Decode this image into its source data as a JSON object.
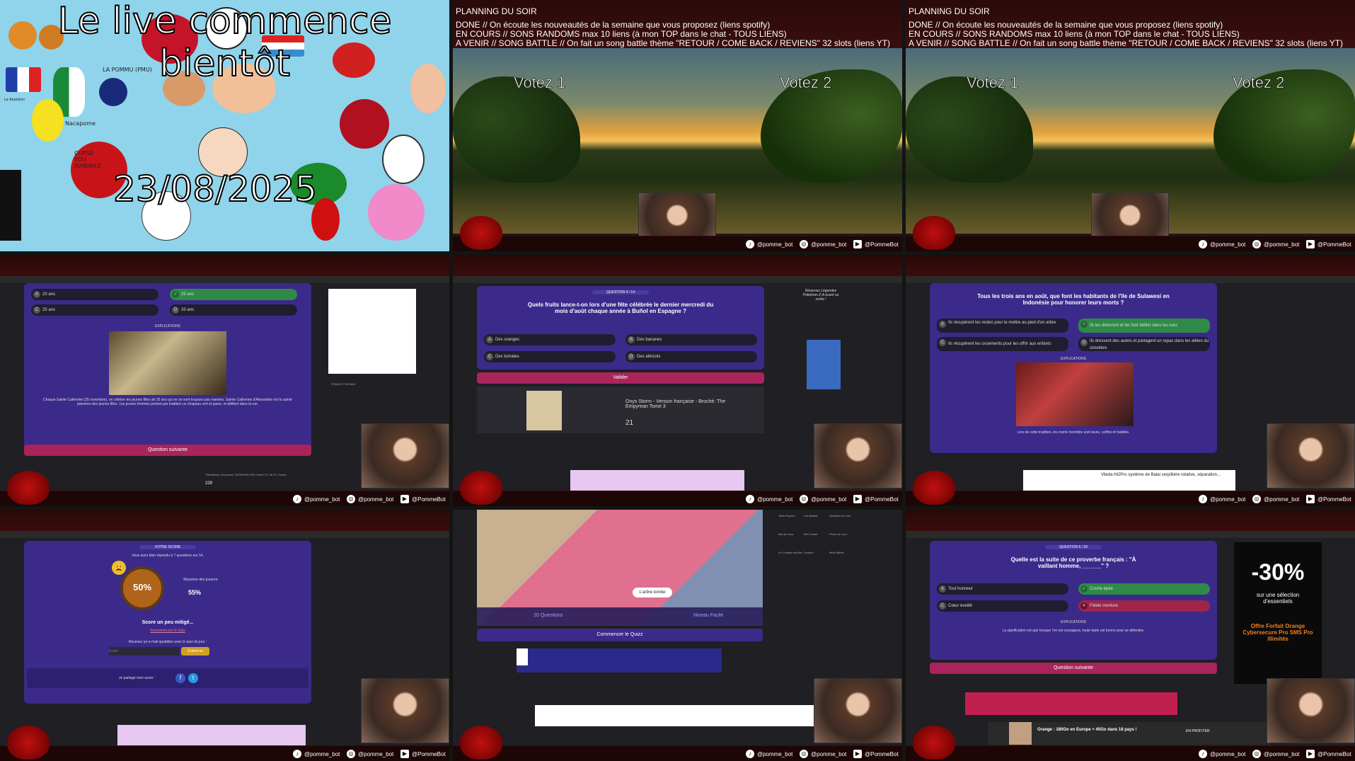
{
  "tile0": {
    "title": "Le live commence bientôt",
    "date": "23/08/2025",
    "labels": [
      "LA POMMU (PMU)",
      "CURSE YOU ISHBAYLE",
      "Nacapome",
      "La Koalaton"
    ]
  },
  "stream": {
    "planning_title": "PLANNING DU SOIR",
    "line_done": "DONE // On écoute les nouveautés de la semaine que vous proposez (liens spotify)",
    "line_current": "EN COURS // SONS RANDOMS max 10 liens (à mon TOP dans le chat - TOUS LIENS)",
    "line_next": "A VENIR // SONG BATTLE // On fait un song battle  thème \"RETOUR / COME BACK / REVIENS\" 32 slots (liens YT)",
    "vote1": "Votez 1",
    "vote2": "Votez 2"
  },
  "socials": {
    "tiktok": "@pomme_bot",
    "instagram": "@pomme_bot",
    "youtube": "@PommeBot"
  },
  "tile3": {
    "options": [
      "20 ans",
      "25 ans",
      "25 ans",
      "33 ans"
    ],
    "explications": "EXPLICATIONS",
    "explanation": "Chaque Sainte Catherine (25 novembre), on célèbre les jeunes filles de 25 ans qui ne se sont toujours pas mariées. Sainte Catherine d'Alexandrie est la sainte patronne des jeunes filles. Les jeunes femmes portent par tradition un chapeau vert et jaune, et défilent dans la rue.",
    "next": "Question suivante",
    "ad_title": "STANLEY FATMAX",
    "ad_sub": "Téléviseurs 40 pouces THOMSON FHD Smart TV, Wi-Fi, Contrô...",
    "ad_price": "229"
  },
  "tile4": {
    "tag": "QUESTION 4 / 14",
    "question": "Quels fruits lance-t-on lors d'une fête célébrée le dernier mercredi du mois d'août chaque année à Buñol en Espagne ?",
    "options": [
      "Des oranges",
      "Des bananes",
      "Des tomates",
      "Des abricots"
    ],
    "submit": "Valider",
    "book": "Onyx Storm - Version française - Broché: The Empyrean Tome 3",
    "book_price": "21",
    "pokemon": "Réservez Légendes Pokémon Z-A avant sa sortie !"
  },
  "tile5": {
    "question": "Tous les trois ans en août, que font les habitants de l'île de Sulawesi en Indonésie pour honorer leurs morts ?",
    "options": [
      "Ils récupèrent les restes pour le mettre au pied d'un arbre",
      "Ils les déterrent et les font défiler dans les rues",
      "Ils récupèrent les ossements pour les offrir aux enfants",
      "Ils dressent des autels et partagent un repas dans les allées du cimetière"
    ],
    "explications": "EXPLICATIONS",
    "caption": "Lors de cette tradition, les morts momifiés sont lavés, coiffés et habillés.",
    "ad": "Vileda Hi2Pro système de Balai serpillière rotative, séparation..."
  },
  "tile6": {
    "tag": "VOTRE SCORE",
    "intro": "Vous avez bien répondu à 7 questions sur 14.",
    "percent": "50%",
    "avg_label": "Moyenne des joueurs:",
    "avg": "55%",
    "verdict": "Score un peu mitigé...",
    "retry": "Recommencer le Quiz",
    "newsletter": "Recevez un e-mail quotidien avec le quiz du jour :",
    "email_placeholder": "Email",
    "subscribe": "S'abonner",
    "share": "Je partage mon score :"
  },
  "tile7": {
    "questions": "20 Questions",
    "level": "Niveau Facile",
    "bubble": "L'arbre tombe",
    "start": "Commencer le Quizz",
    "side_items": [
      "Tests Psycho",
      "Les Battles",
      "Question du Jour",
      "Mot du Jour",
      "Mot Croisé",
      "Photo du Jour",
      "Le Compte est Bon",
      "Sudoku",
      "Mots Mêlés"
    ]
  },
  "tile8": {
    "tag": "QUESTION 6 / 20",
    "question": "Quelle est la suite de ce proverbe français : \"À vaillant homme, ______\" ?",
    "options": [
      "Tout honneur",
      "Courte épée",
      "Cœur éveillé",
      "Fidèle monture"
    ],
    "explications": "EXPLICATIONS",
    "explanation": "La signification est que lorsque l'on est courageux, toute épée est bonne pour se défendre.",
    "next": "Question suivante",
    "promo": "-30%",
    "promo_text": "sur une sélection d'essentiels",
    "promo_offer": "Offre Forfait Orange Cybersecure Pro SMS Pro illimités",
    "orange": "Orange : 180Go en Europe + 40Go dans 18 pays !",
    "orange_btn": "EN PROFITER"
  }
}
